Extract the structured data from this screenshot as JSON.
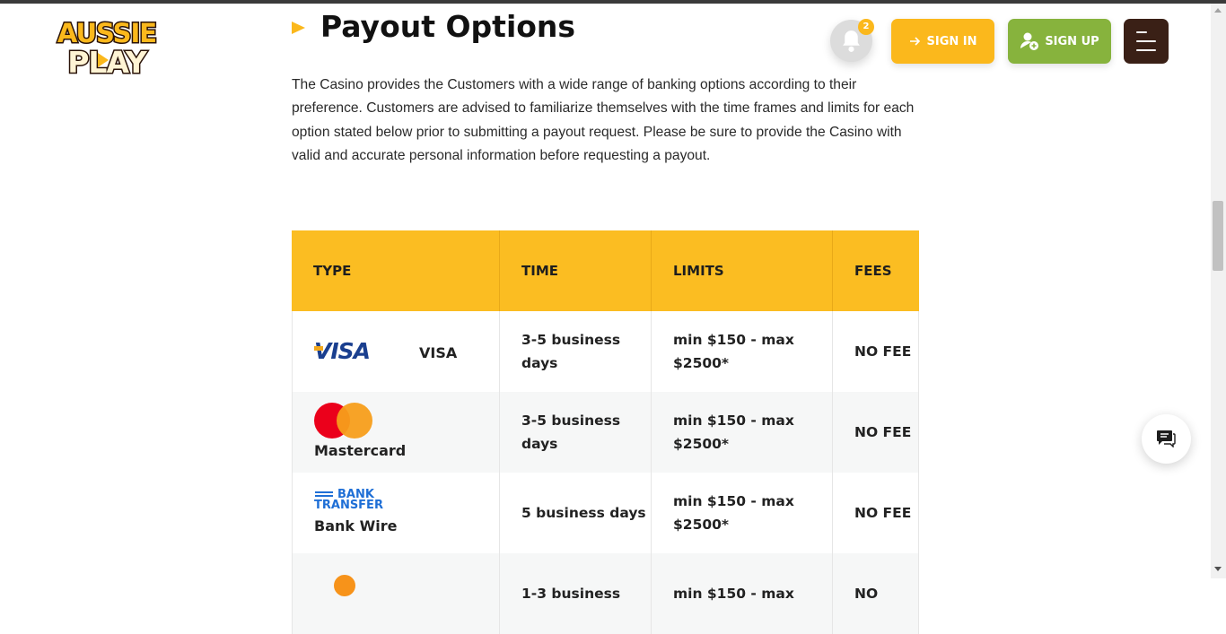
{
  "logo": {
    "line1": "AUSSIE",
    "line2": "PLAY"
  },
  "header": {
    "notifications_count": "2",
    "signin_label": "SIGN IN",
    "signup_label": "SIGN UP"
  },
  "section": {
    "title": "Payout Options",
    "intro": "The Casino provides the Customers with a wide range of banking options according to their preference. Customers are advised to familiarize themselves with the time frames and limits for each option stated below prior to submitting a payout request. Please be sure to provide the Casino with valid and accurate personal information before requesting a payout."
  },
  "table": {
    "headers": [
      "TYPE",
      "TIME",
      "LIMITS",
      "FEES"
    ],
    "rows": [
      {
        "type_logo": "VISA",
        "type": "VISA",
        "time": "3-5 business days",
        "limits": "min $150 - max $2500*",
        "fees": "NO FEE"
      },
      {
        "type_logo": "",
        "type": "Mastercard",
        "time": "3-5 business days",
        "limits": "min $150 - max $2500*",
        "fees": "NO FEE"
      },
      {
        "type_logo": "BANK TRANSFER",
        "type_logo_line1": "BANK",
        "type_logo_line2": "TRANSFER",
        "type": "Bank Wire",
        "time": "5 business days",
        "limits": "min $150 - max $2500*",
        "fees": "NO FEE"
      },
      {
        "type_logo": "",
        "type": "",
        "time": "1-3 business",
        "limits": "min $150 - max",
        "fees": "NO"
      }
    ]
  },
  "colors": {
    "accent": "#fbb81c",
    "signup": "#87b33d",
    "menu": "#3a2016"
  },
  "icons": [
    "bell-icon",
    "arrow-right-icon",
    "user-plus-icon",
    "hamburger-icon",
    "chat-icon"
  ]
}
